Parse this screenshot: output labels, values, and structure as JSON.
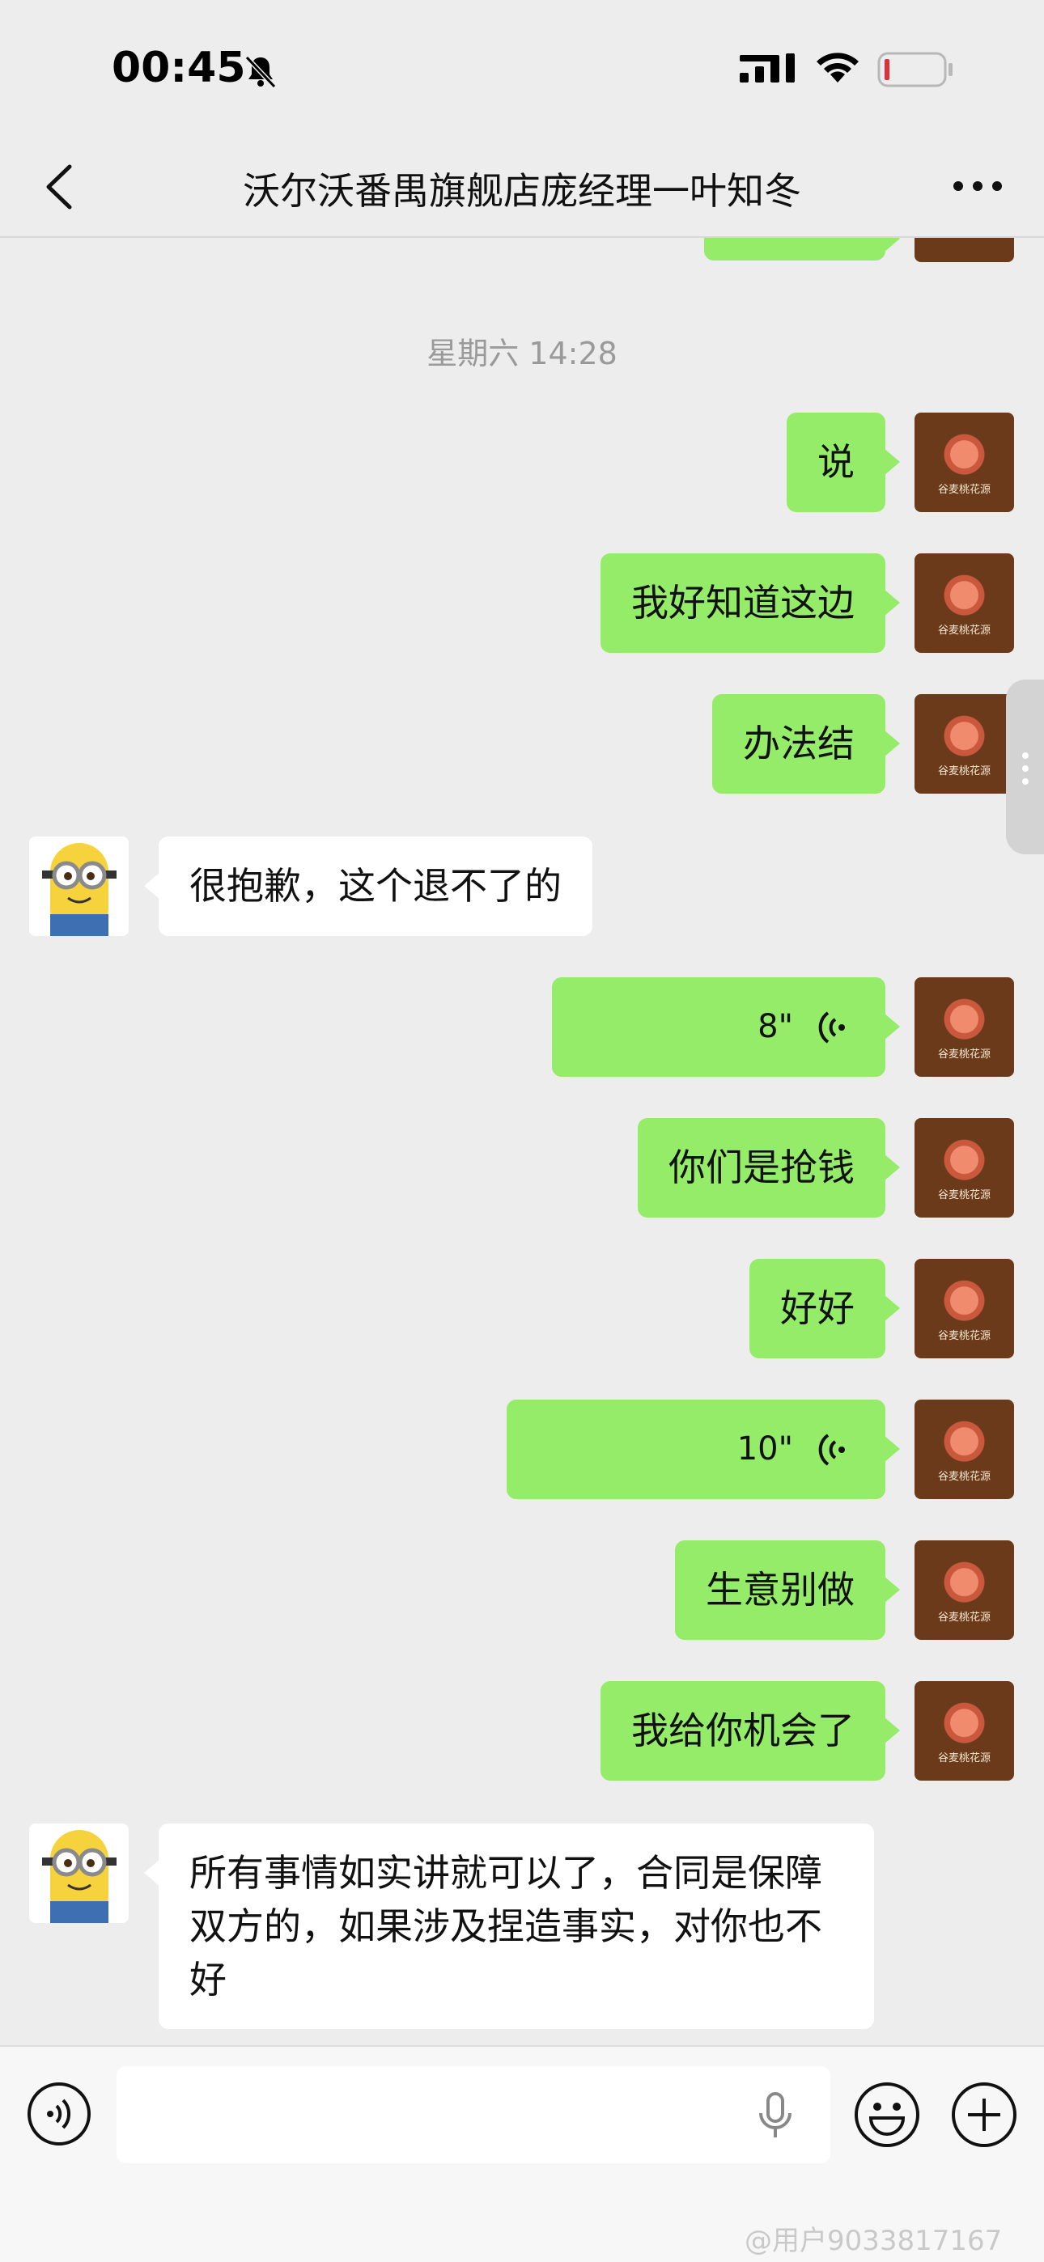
{
  "status_bar": {
    "time": "00:45",
    "icons": [
      "bell-slash-icon",
      "cellular-signal-icon",
      "wifi-icon",
      "battery-low-icon"
    ]
  },
  "nav": {
    "title": "沃尔沃番禺旗舰店庞经理一叶知冬",
    "back_icon": "chevron-left-icon",
    "more_icon": "more-dots-icon"
  },
  "chat": {
    "timestamp": "星期六 14:28",
    "messages": [
      {
        "from": "me",
        "type": "text",
        "text": "说"
      },
      {
        "from": "me",
        "type": "text",
        "text": "我好知道这边"
      },
      {
        "from": "me",
        "type": "text",
        "text": "办法结"
      },
      {
        "from": "other",
        "type": "text",
        "text": "很抱歉，这个退不了的"
      },
      {
        "from": "me",
        "type": "voice",
        "duration": "8\""
      },
      {
        "from": "me",
        "type": "text",
        "text": "你们是抢钱"
      },
      {
        "from": "me",
        "type": "text",
        "text": "好好"
      },
      {
        "from": "me",
        "type": "voice",
        "duration": "10\""
      },
      {
        "from": "me",
        "type": "text",
        "text": "生意别做"
      },
      {
        "from": "me",
        "type": "text",
        "text": "我给你机会了"
      },
      {
        "from": "other",
        "type": "text",
        "text": "所有事情如实讲就可以了，合同是保障双方的，如果涉及捏造事实，对你也不好"
      }
    ],
    "my_avatar_caption": "谷麦桃花源",
    "colors": {
      "my_bubble": "#95ec69",
      "other_bubble": "#ffffff",
      "background": "#ededed"
    }
  },
  "input_bar": {
    "voice_icon": "voice-mode-icon",
    "mic_icon": "microphone-icon",
    "emoji_icon": "emoji-icon",
    "plus_icon": "plus-circle-icon"
  },
  "watermark": "@用户9033817167"
}
